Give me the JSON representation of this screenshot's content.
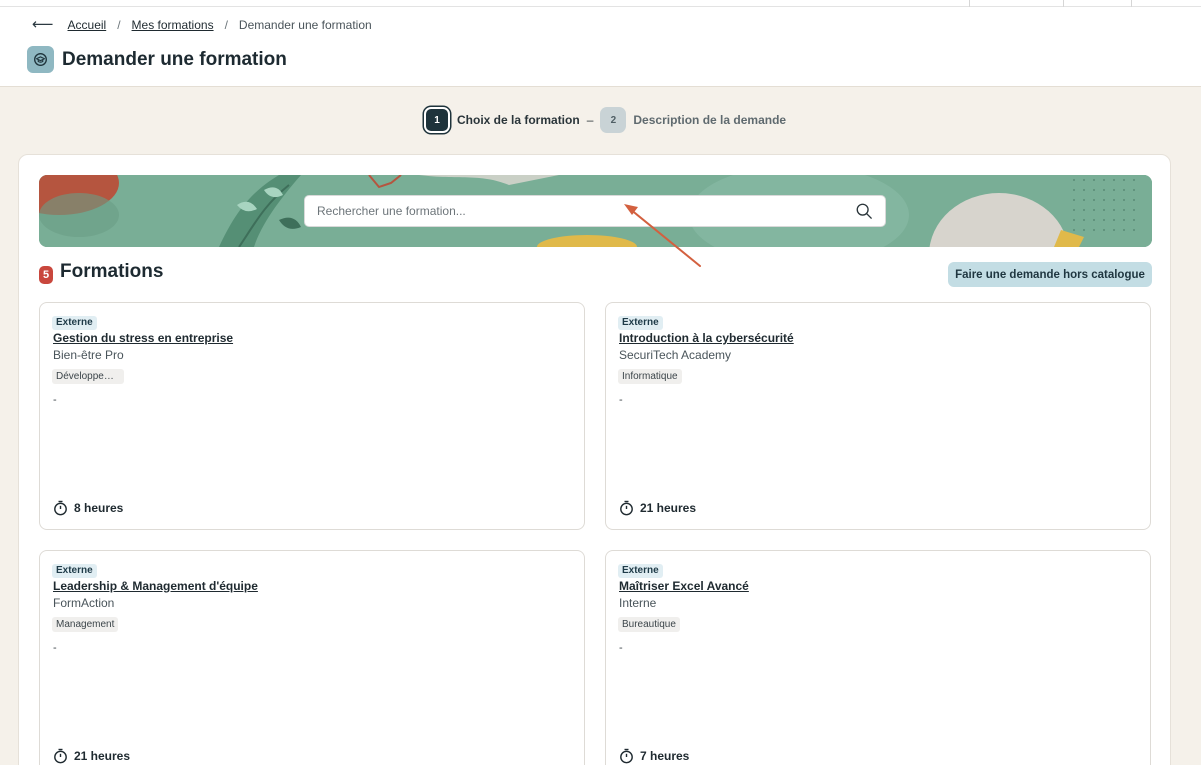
{
  "breadcrumb": {
    "back_icon": "arrow-left-icon",
    "items": [
      "Accueil",
      "Mes formations"
    ],
    "current": "Demander une formation"
  },
  "page": {
    "title": "Demander une formation",
    "icon": "graduation-icon",
    "accent": "#8fb8c2"
  },
  "stepper": {
    "steps": [
      {
        "number": "1",
        "label": "Choix de la formation"
      },
      {
        "number": "2",
        "label": "Description de la demande"
      }
    ],
    "separator": "–"
  },
  "search": {
    "placeholder": "Rechercher une formation...",
    "value": "",
    "icon": "search-icon"
  },
  "formations": {
    "count": "5",
    "title": "Formations",
    "hors_catalogue_label": "Faire une demande hors catalogue",
    "items": [
      {
        "tag": "Externe",
        "title": "Gestion du stress en entreprise",
        "provider": "Bien-être Pro",
        "category": "Développement personnel",
        "description": "-",
        "duration": "8 heures"
      },
      {
        "tag": "Externe",
        "title": "Introduction à la cybersécurité",
        "provider": "SecuriTech Academy",
        "category": "Informatique",
        "description": "-",
        "duration": "21 heures"
      },
      {
        "tag": "Externe",
        "title": "Leadership & Management d'équipe",
        "provider": "FormAction",
        "category": "Management",
        "description": "-",
        "duration": "21 heures"
      },
      {
        "tag": "Externe",
        "title": "Maîtriser Excel Avancé",
        "provider": "Interne",
        "category": "Bureautique",
        "description": "-",
        "duration": "7 heures"
      }
    ]
  },
  "colors": {
    "background": "#f5f1ea",
    "banner": "#79ae96",
    "badge": "#c9473d",
    "annotation_arrow": "#d3603f"
  }
}
